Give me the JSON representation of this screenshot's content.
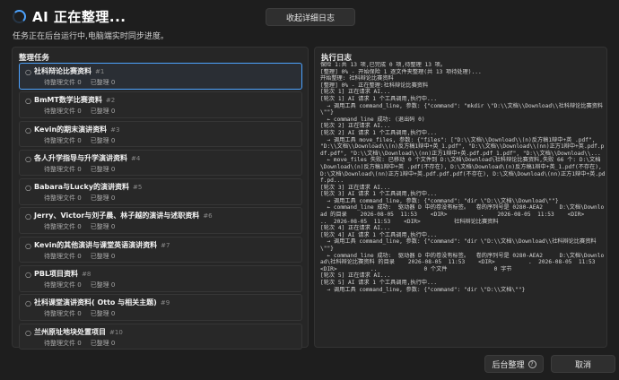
{
  "header": {
    "title": "AI 正在整理...",
    "subtitle": "任务正在后台运行中,电脑端实时同步进度。",
    "close_log_label": "收起详细日志"
  },
  "tasks_panel": {
    "heading": "整理任务",
    "items": [
      {
        "name": "社科辩论比赛资料",
        "num": "#1",
        "pending": "待整理文件 0",
        "done": "已整理 0"
      },
      {
        "name": "BmMT数学比赛资料",
        "num": "#2",
        "pending": "待整理文件 0",
        "done": "已整理 0"
      },
      {
        "name": "Kevin的期末演讲资料",
        "num": "#3",
        "pending": "待整理文件 0",
        "done": "已整理 0"
      },
      {
        "name": "各人升学指导与升学演讲资料",
        "num": "#4",
        "pending": "待整理文件 0",
        "done": "已整理 0"
      },
      {
        "name": "Babara与Lucky的演讲资料",
        "num": "#5",
        "pending": "待整理文件 0",
        "done": "已整理 0"
      },
      {
        "name": "Jerry、Victor与刘子晨、林子越的演讲与述职资料",
        "num": "#6",
        "pending": "待整理文件 0",
        "done": "已整理 0"
      },
      {
        "name": "Kevin的其他演讲与课堂英语演讲资料",
        "num": "#7",
        "pending": "待整理文件 0",
        "done": "已整理 0"
      },
      {
        "name": "PBL项目资料",
        "num": "#8",
        "pending": "待整理文件 0",
        "done": "已整理 0"
      },
      {
        "name": "社科课堂演讲资料( Otto 与相关主题)",
        "num": "#9",
        "pending": "待整理文件 0",
        "done": "已整理 0"
      },
      {
        "name": "兰州原址地块处置项目",
        "num": "#10",
        "pending": "待整理文件 0",
        "done": "已整理 0"
      }
    ]
  },
  "log_panel": {
    "heading": "执行日志",
    "lines": [
      "保险 1:共 13 项,已完成 0 项,待整理 13 项。",
      "[整理] 0% - 开始保险 1 逐文件夹整理(共 13 项待处理)...",
      "开始整理: 社科辩论比赛资料",
      "[整理] 0% - 正在整理:社科辩论比赛资料",
      "[轮次 1] 正在请求 AI...",
      "[轮次 1] AI 请求 1 个工具调用,执行中...",
      "  → 调用工具 command_line, 参数: {\"command\": \"mkdir \\\"D:\\\\文档\\\\Download\\\\社科辩论比赛资料\\\"\"}",
      "  ← command_line 成功: (退出码 0)",
      "[轮次 2] 正在请求 AI...",
      "[轮次 2] AI 请求 1 个工具调用,执行中...",
      "  → 调用工具 move_files, 参数: {\"files\": [\"D:\\\\文档\\\\Download\\\\(n)反方稿1辩中+英 .pdf\", \"D:\\\\文档\\\\Download\\\\(n)反方稿1辩中+英_1.pdf\", \"D:\\\\文档\\\\Download\\\\(nn)正方1辩中+英.pdf.pdf.pdf\", \"D:\\\\文档\\\\Download\\\\(nn)正方1辩中+英.pdf.pdf_1.pdf\", \"D:\\\\文档\\\\Download\\\\...",
      "  ← move_files 失败: 已移动 0 个文件到 D:\\文档\\Download\\社科辩论比赛资料,失败 66 个: D:\\文档\\Download\\(n)反方稿1辩中+英 .pdf(不存在), D:\\文档\\Download\\(n)反方稿1辩中+英_1.pdf(不存在), D:\\文档\\Download\\(nn)正方1辩中+英.pdf.pdf.pdf(不存在), D:\\文档\\Download\\(nn)正方1辩中+英.pdf.pd...",
      "[轮次 3] 正在请求 AI...",
      "[轮次 3] AI 请求 1 个工具调用,执行中...",
      "  → 调用工具 command_line, 参数: {\"command\": \"dir \\\"D:\\\\文档\\\\Download\\\"\"}",
      "  ← command_line 成功:  驱动器 D 中的卷没有标签。  卷的序列号是 0280-AEA2     D:\\文档\\Download 的目录    2026-08-05  11:53    <DIR>          .    2026-08-05  11:53    <DIR>          ..  2026-08-05  11:53    <DIR>          社科辩论比赛资料",
      "[轮次 4] 正在请求 AI...",
      "[轮次 4] AI 请求 1 个工具调用,执行中...",
      "  → 调用工具 command_line, 参数: {\"command\": \"dir \\\"D:\\\\文档\\\\Download\\\\社科辩论比赛资料\\\"\"}",
      "  ← command_line 成功:  驱动器 D 中的卷没有标签。  卷的序列号是 0280-AEA2     D:\\文档\\Download\\社科辩论比赛资料 的目录    2026-08-05  11:53    <DIR>          .  2026-08-05  11:53    <DIR>          ..              0 个文件              0 字节",
      "[轮次 5] 正在请求 AI...",
      "[轮次 5] AI 请求 1 个工具调用,执行中...",
      "  → 调用工具 command_line, 参数: {\"command\": \"dir \\\"D:\\\\文档\\\"\"}"
    ]
  },
  "footer": {
    "background_label": "后台整理",
    "help_glyph": "?",
    "cancel_label": "取消"
  },
  "colors": {
    "accent": "#4da3ff",
    "background": "#1e1e1e",
    "panel": "#262626"
  }
}
